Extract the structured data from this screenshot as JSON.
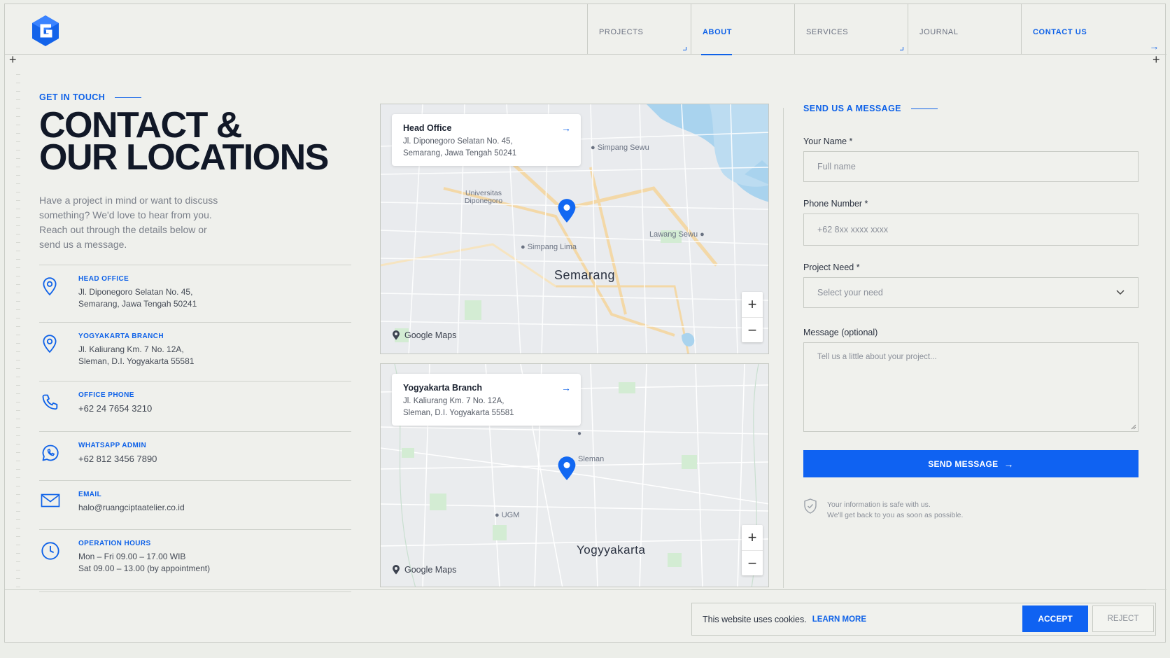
{
  "nav": {
    "items": [
      {
        "label": "PROJECTS",
        "width": 156
      },
      {
        "label": "ABOUT",
        "width": 157
      },
      {
        "label": "SERVICES",
        "width": 162
      },
      {
        "label": "JOURNAL",
        "width": 162
      },
      {
        "label": "CONTACT US",
        "width": 190
      }
    ],
    "active": "ABOUT"
  },
  "hero": {
    "eyebrow": "GET IN TOUCH",
    "title_line1": "CONTACT &",
    "title_line2": "OUR LOCATIONS",
    "lead": "Have a project in mind or want to discuss something? We'd love to hear from you. Reach out through the details below or send us a message."
  },
  "info": [
    {
      "icon": "location-pin-icon",
      "label": "HEAD OFFICE",
      "line1": "Jl. Diponegoro Selatan No. 45,",
      "line2": "Semarang, Jawa Tengah 50241"
    },
    {
      "icon": "location-pin-icon",
      "label": "YOGYAKARTA BRANCH",
      "line1": "Jl. Kaliurang Km. 7 No. 12A,",
      "line2": "Sleman, D.I. Yogyakarta 55581"
    },
    {
      "icon": "phone-icon",
      "label": "OFFICE PHONE",
      "line1": "+62 24 7654 3210",
      "line2": ""
    },
    {
      "icon": "whatsapp-icon",
      "label": "WHATSAPP ADMIN",
      "line1": "+62 812 3456 7890",
      "line2": ""
    },
    {
      "icon": "email-icon",
      "label": "EMAIL",
      "line1": "halo@ruangciptaatelier.co.id",
      "line2": ""
    },
    {
      "icon": "clock-icon",
      "label": "OPERATION HOURS",
      "line1": "Mon – Fri 09.00 – 17.00 WIB",
      "line2": "Sat 09.00 – 13.00 (by appointment)"
    }
  ],
  "maps": {
    "head": {
      "card_title": "Head Office",
      "card_line1": "Jl. Diponegoro Selatan No. 45,",
      "card_line2": "Semarang, Jawa Tengah 50241",
      "city": "Semarang",
      "places": [
        "Simpang Sewu",
        "Universitas Diponegoro",
        "Simpang Lima",
        "Lawang Sewu"
      ]
    },
    "branch": {
      "card_title": "Yogyakarta Branch",
      "card_line1": "Jl. Kaliurang Km. 7 No. 12A,",
      "card_line2": "Sleman, D.I. Yogyakarta 55581",
      "city": "Yogyyakarta",
      "places": [
        "Sleman",
        "UGM"
      ]
    },
    "attribution": "Google Maps",
    "zoom_in": "+",
    "zoom_out": "−"
  },
  "form": {
    "eyebrow": "SEND US A MESSAGE",
    "name_label": "Your Name *",
    "name_placeholder": "Full name",
    "phone_label": "Phone Number *",
    "phone_placeholder": "+62 8xx xxxx xxxx",
    "need_label": "Project Need *",
    "need_value": "Select your need",
    "message_label": "Message (optional)",
    "message_placeholder": "Tell us a little about your project...",
    "submit": "SEND MESSAGE",
    "safe_line1": "Your information is safe with us.",
    "safe_line2": "We'll get back to you as soon as possible."
  },
  "cookie": {
    "text": "This website uses cookies.",
    "learn_more": "LEARN MORE",
    "accept": "ACCEPT",
    "reject": "REJECT"
  },
  "colors": {
    "accent": "#0f62f2",
    "background": "#eff0ec",
    "water": "#a9d3ee"
  }
}
